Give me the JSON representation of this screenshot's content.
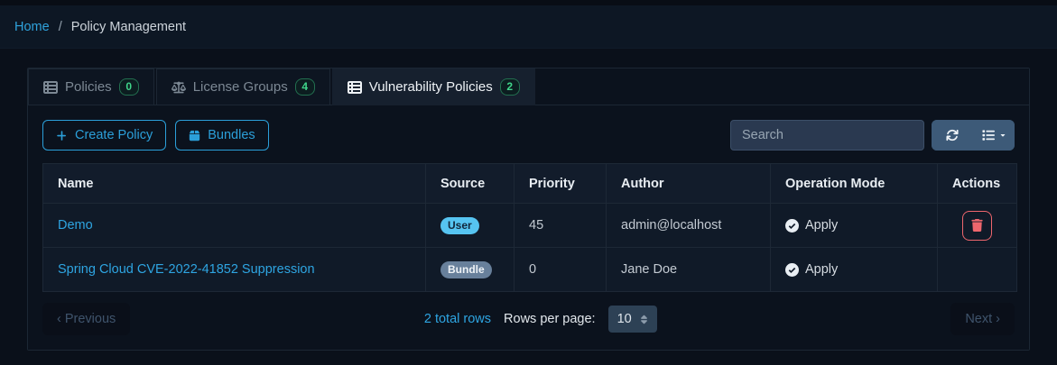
{
  "colors": {
    "accent_blue": "#2fa3dd",
    "badge_green": "#3fd58a",
    "danger_red": "#ee666d",
    "user_badge_bg": "#56c4f1",
    "bundle_badge_bg": "#68809b",
    "toolbar_group_bg": "#3d5a78",
    "page_bg": "#0a101a",
    "panel_bg": "#0b121d"
  },
  "breadcrumb": {
    "home": "Home",
    "separator": "/",
    "current": "Policy Management"
  },
  "tabs": [
    {
      "label": "Policies",
      "count": "0",
      "icon": "table-list-icon",
      "active": false
    },
    {
      "label": "License Groups",
      "count": "4",
      "icon": "scales-icon",
      "active": false
    },
    {
      "label": "Vulnerability Policies",
      "count": "2",
      "icon": "table-list-icon",
      "active": true
    }
  ],
  "toolbar": {
    "create_policy": "Create Policy",
    "bundles": "Bundles",
    "search_placeholder": "Search",
    "refresh_icon": "refresh-icon",
    "columns_icon": "list-columns-icon"
  },
  "table": {
    "headers": {
      "name": "Name",
      "source": "Source",
      "priority": "Priority",
      "author": "Author",
      "operation_mode": "Operation Mode",
      "actions": "Actions"
    },
    "rows": [
      {
        "name": "Demo",
        "source": "User",
        "priority": "45",
        "author": "admin@localhost",
        "operation_mode": "Apply"
      },
      {
        "name": "Spring Cloud CVE-2022-41852 Suppression",
        "source": "Bundle",
        "priority": "0",
        "author": "Jane Doe",
        "operation_mode": "Apply"
      }
    ]
  },
  "pagination": {
    "previous": "‹ Previous",
    "total": "2 total rows",
    "rows_per_page_label": "Rows per page:",
    "rows_per_page_value": "10",
    "next": "Next ›"
  }
}
